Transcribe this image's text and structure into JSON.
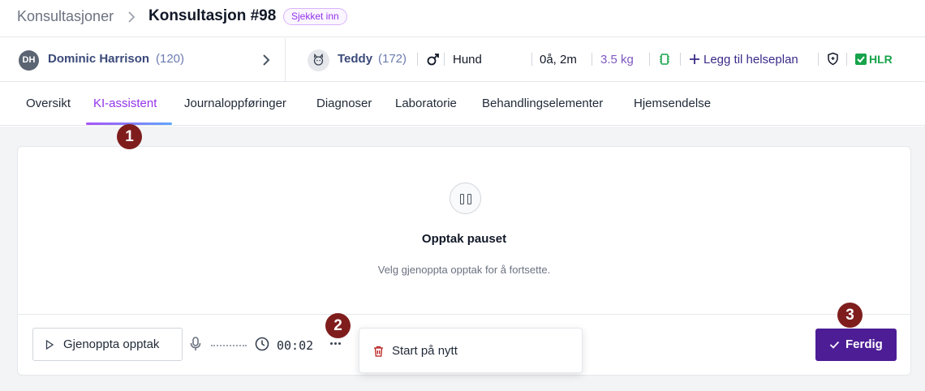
{
  "breadcrumb": {
    "parent": "Konsultasjoner",
    "current": "Konsultasjon #98",
    "status": "Sjekket inn"
  },
  "owner": {
    "initials": "DH",
    "name": "Dominic Harrison",
    "id": "(120)"
  },
  "animal": {
    "name": "Teddy",
    "id": "(172)",
    "species": "Hund",
    "age": "0å, 2m",
    "weight": "3.5 kg",
    "health_plan_link": "Legg til helseplan",
    "hlr_label": "HLR"
  },
  "tabs": [
    {
      "label": "Oversikt"
    },
    {
      "label": "KI-assistent"
    },
    {
      "label": "Journaloppføringer"
    },
    {
      "label": "Diagnoser"
    },
    {
      "label": "Laboratorie"
    },
    {
      "label": "Behandlingselementer"
    },
    {
      "label": "Hjemsendelse"
    }
  ],
  "active_tab": "KI-assistent",
  "recording": {
    "title": "Opptak pauset",
    "subtitle": "Velg gjenoppta opptak for å fortsette.",
    "resume_label": "Gjenoppta opptak",
    "elapsed": "00:02",
    "menu_restart": "Start på nytt",
    "done_label": "Ferdig"
  },
  "annotations": [
    "1",
    "2",
    "3"
  ],
  "colors": {
    "accent": "#4c1d95",
    "tab_active": "#9333ea",
    "hlr": "#16a34a",
    "marker": "#7f1d1d"
  }
}
